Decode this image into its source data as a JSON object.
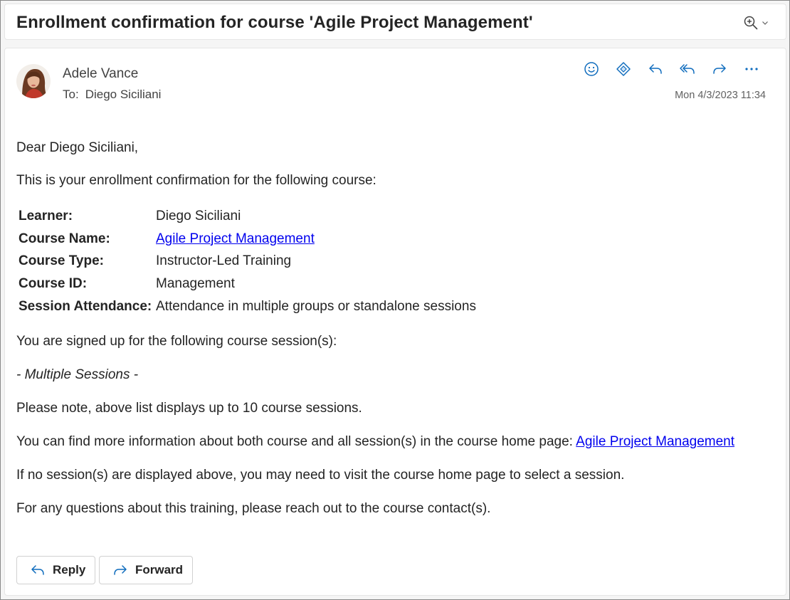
{
  "subject": "Enrollment confirmation for course 'Agile Project Management'",
  "header": {
    "sender": "Adele Vance",
    "to_label": "To:",
    "to_value": "Diego Siciliani",
    "timestamp": "Mon 4/3/2023 11:34",
    "actions": [
      "smile-icon",
      "reaction-icon",
      "reply-icon",
      "reply-all-icon",
      "forward-icon",
      "more-icon"
    ]
  },
  "body": {
    "greeting": "Dear Diego Siciliani,",
    "intro": "This is your enrollment confirmation for the following course:",
    "info": [
      {
        "key": "Learner:",
        "value": "Diego Siciliani"
      },
      {
        "key": "Course Name:",
        "value": "Agile Project Management"
      },
      {
        "key": "Course Type:",
        "value": "Instructor-Led Training"
      },
      {
        "key": "Course ID:",
        "value": "Management"
      },
      {
        "key": "Session Attendance:",
        "value": "Attendance in multiple groups or standalone sessions"
      }
    ],
    "signed_up": "You are signed up for the following course session(s):",
    "sessions": "- Multiple Sessions -",
    "note": "Please note, above list displays up to 10 course sessions.",
    "more_info": "You can find more information about both course and all session(s) in the course home page:",
    "more_info_link": "Agile Project Management",
    "no_sessions": "If no session(s) are displayed above, you may need to visit the course home page to select a session.",
    "questions": "For any questions about this training, please reach out to the course contact(s)."
  },
  "footer": {
    "reply_label": "Reply",
    "forward_label": "Forward"
  },
  "colors": {
    "accent": "#0f6cbd",
    "link": "#0000ee"
  }
}
